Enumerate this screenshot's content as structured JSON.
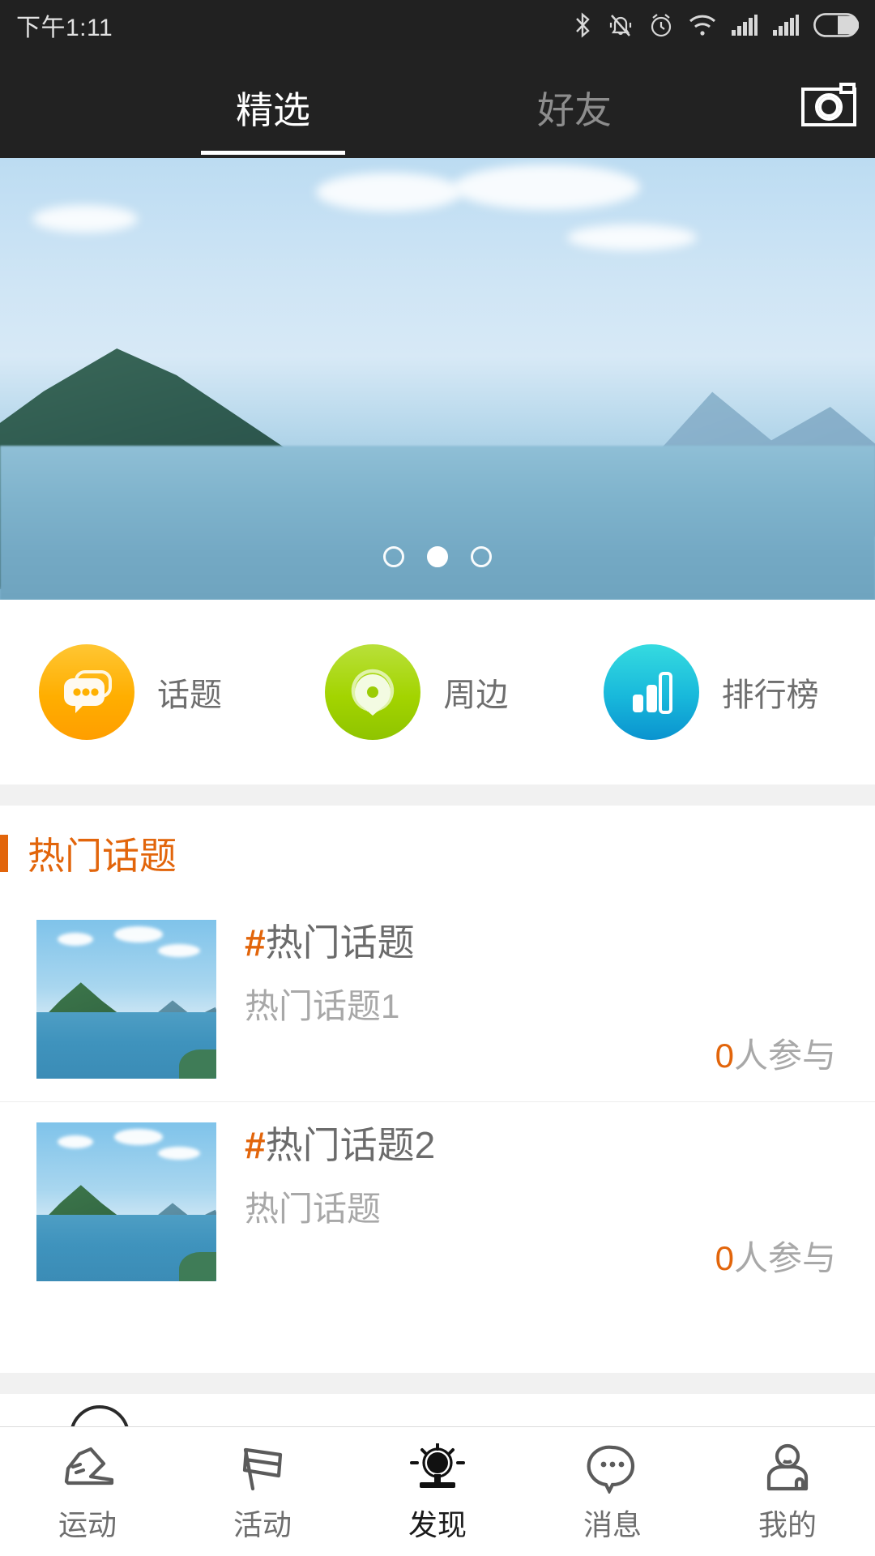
{
  "statusbar": {
    "time": "下午1:11",
    "icons": [
      "bluetooth-icon",
      "vibrate-off-icon",
      "alarm-icon",
      "wifi-icon",
      "signal-icon-1",
      "signal-icon-2",
      "battery-icon"
    ]
  },
  "header": {
    "tabs": [
      {
        "label": "精选",
        "active": true
      },
      {
        "label": "好友",
        "active": false
      }
    ],
    "camera_icon": "camera-icon",
    "background": "#222222",
    "active_color": "#ffffff",
    "inactive_color": "#8d8d8d"
  },
  "banner": {
    "alt": "山水风景",
    "dots": {
      "count": 3,
      "active_index": 1
    }
  },
  "quick_actions": [
    {
      "label": "话题",
      "icon": "chat-bubble-icon",
      "color": "#ffae00"
    },
    {
      "label": "周边",
      "icon": "location-pin-icon",
      "color": "#a3d400"
    },
    {
      "label": "排行榜",
      "icon": "bar-chart-icon",
      "color": "#18b8db"
    }
  ],
  "section": {
    "title": "热门话题",
    "accent": "#e2650b"
  },
  "topics": [
    {
      "hash": "#",
      "title": "热门话题",
      "subtitle": "热门话题1",
      "count": "0",
      "count_suffix": "人参与",
      "thumb_alt": "山水缩略图"
    },
    {
      "hash": "#",
      "title": "热门话题2",
      "subtitle": "热门话题",
      "count": "0",
      "count_suffix": "人参与",
      "thumb_alt": "山水缩略图"
    }
  ],
  "bottom_nav": [
    {
      "label": "运动",
      "icon": "shoe-icon",
      "active": false
    },
    {
      "label": "活动",
      "icon": "flag-icon",
      "active": false
    },
    {
      "label": "发现",
      "icon": "discover-lamp-icon",
      "active": true
    },
    {
      "label": "消息",
      "icon": "message-bubble-icon",
      "active": false
    },
    {
      "label": "我的",
      "icon": "user-profile-icon",
      "active": false
    }
  ]
}
